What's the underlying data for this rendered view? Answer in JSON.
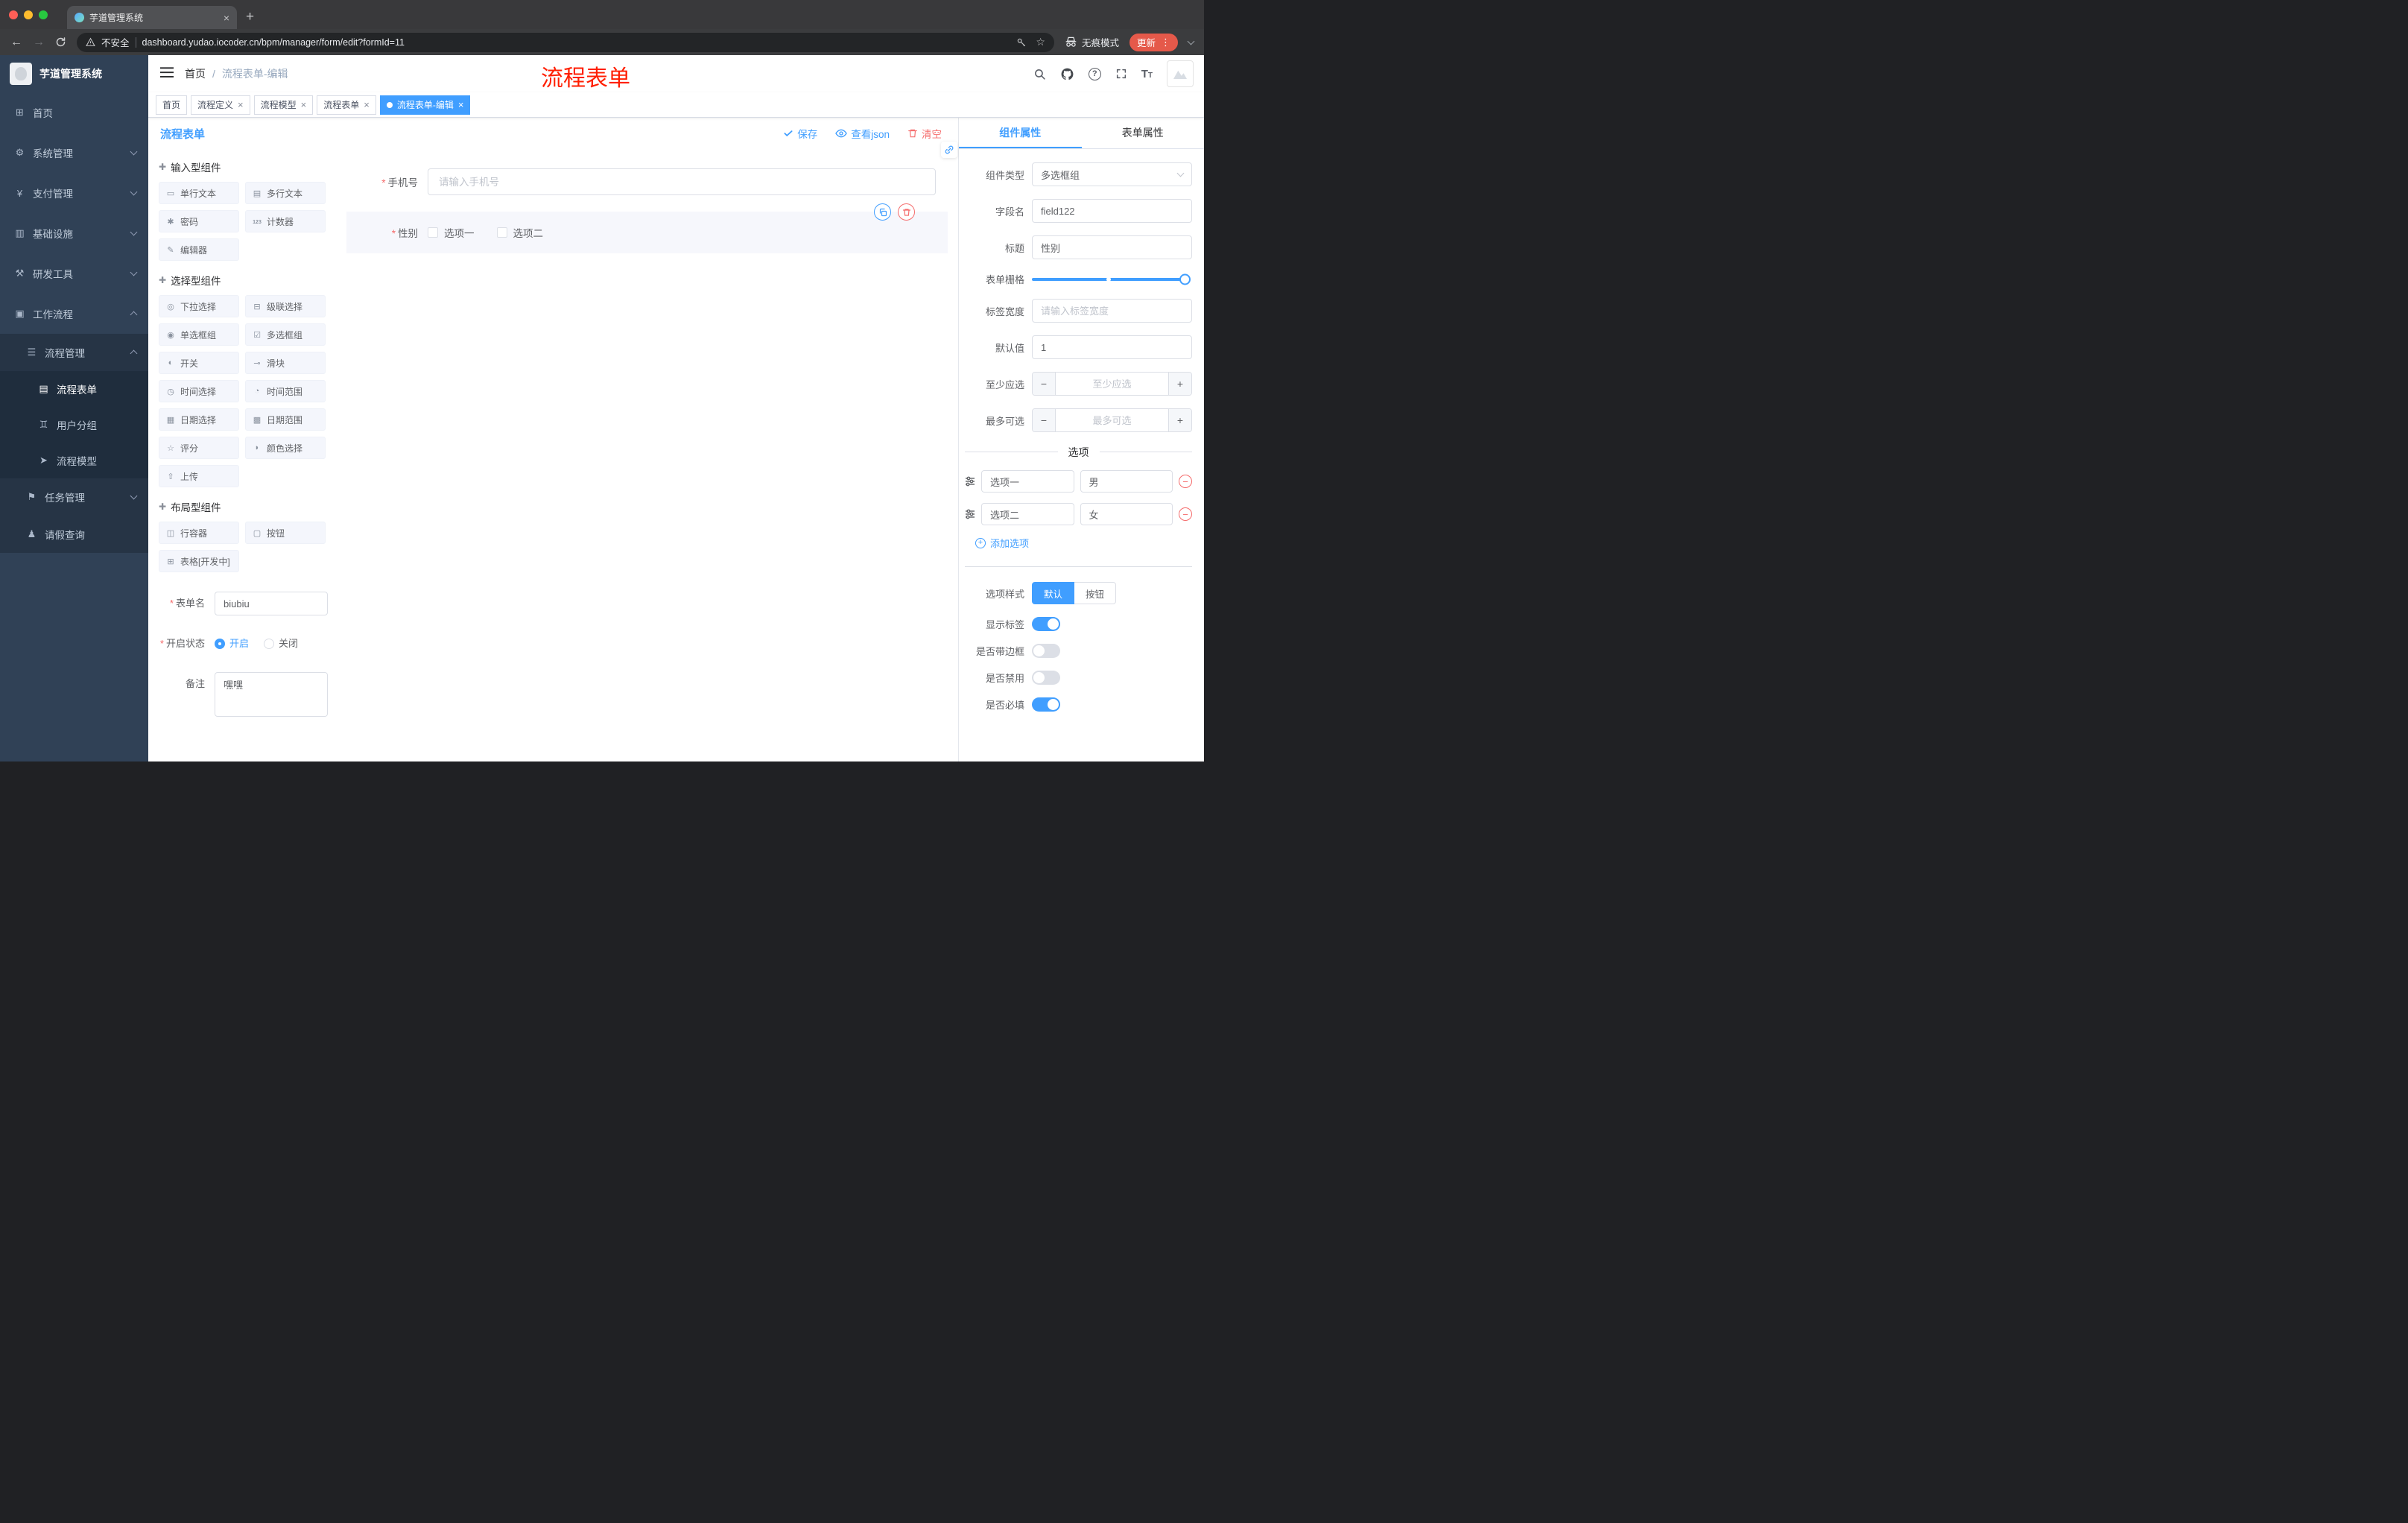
{
  "colors": {
    "accent": "#409EFF",
    "danger": "#F56C6C",
    "sidebar_bg": "#304156",
    "annotation_red": "#FF1E00",
    "update_button": "#E5594A"
  },
  "browser": {
    "tab_title": "芋道管理系统",
    "security_label": "不安全",
    "url": "dashboard.yudao.iocoder.cn/bpm/manager/form/edit?formId=11",
    "incognito_label": "无痕模式",
    "update_label": "更新"
  },
  "annotation": "流程表单",
  "sidebar": {
    "logo_title": "芋道管理系统",
    "items": [
      {
        "label": "首页",
        "icon": "home-icon"
      },
      {
        "label": "系统管理",
        "icon": "gear-icon"
      },
      {
        "label": "支付管理",
        "icon": "payment-icon"
      },
      {
        "label": "基础设施",
        "icon": "infrastructure-icon"
      },
      {
        "label": "研发工具",
        "icon": "devtools-icon"
      },
      {
        "label": "工作流程",
        "icon": "workflow-icon"
      },
      {
        "label": "流程管理",
        "icon": "process-manage-icon"
      },
      {
        "label": "流程表单",
        "icon": "process-form-icon"
      },
      {
        "label": "用户分组",
        "icon": "user-group-icon"
      },
      {
        "label": "流程模型",
        "icon": "process-model-icon"
      },
      {
        "label": "任务管理",
        "icon": "task-manage-icon"
      },
      {
        "label": "请假查询",
        "icon": "leave-query-icon"
      }
    ]
  },
  "navbar": {
    "breadcrumb_home": "首页",
    "breadcrumb_separator": "/",
    "breadcrumb_current": "流程表单-编辑"
  },
  "tags": [
    {
      "label": "首页",
      "closable": false,
      "active": false
    },
    {
      "label": "流程定义",
      "closable": true,
      "active": false
    },
    {
      "label": "流程模型",
      "closable": true,
      "active": false
    },
    {
      "label": "流程表单",
      "closable": true,
      "active": false
    },
    {
      "label": "流程表单-编辑",
      "closable": true,
      "active": true
    }
  ],
  "designer": {
    "title": "流程表单",
    "save_label": "保存",
    "view_json_label": "查看json",
    "clear_label": "清空",
    "palette": {
      "section_input": "输入型组件",
      "section_select": "选择型组件",
      "section_layout": "布局型组件",
      "input_items": [
        "单行文本",
        "多行文本",
        "密码",
        "计数器",
        "编辑器"
      ],
      "input_item_icons": [
        "single-line-text-icon",
        "multi-line-text-icon",
        "password-icon",
        "counter-icon",
        "editor-icon"
      ],
      "select_items": [
        "下拉选择",
        "级联选择",
        "单选框组",
        "多选框组",
        "开关",
        "滑块",
        "时间选择",
        "时间范围",
        "日期选择",
        "日期范围",
        "评分",
        "颜色选择",
        "上传"
      ],
      "select_item_icons": [
        "select-icon",
        "cascader-icon",
        "radio-group-icon",
        "checkbox-group-icon",
        "switch-icon",
        "slider-icon",
        "time-picker-icon",
        "time-range-icon",
        "date-picker-icon",
        "date-range-icon",
        "rate-icon",
        "color-picker-icon",
        "upload-icon"
      ],
      "layout_items": [
        "行容器",
        "按钮",
        "表格[开发中]"
      ],
      "layout_item_icons": [
        "row-container-icon",
        "button-icon",
        "table-icon"
      ]
    },
    "meta_form": {
      "name_label": "表单名",
      "name_value": "biubiu",
      "status_label": "开启状态",
      "status_on": "开启",
      "status_off": "关闭",
      "status_value": "开启",
      "remark_label": "备注",
      "remark_value": "嘿嘿"
    },
    "canvas": {
      "phone_label": "手机号",
      "phone_placeholder": "请输入手机号",
      "gender_label": "性别",
      "gender_option1": "选项一",
      "gender_option2": "选项二"
    }
  },
  "props": {
    "tab_component": "组件属性",
    "tab_form": "表单属性",
    "type_label": "组件类型",
    "type_value": "多选框组",
    "field_label": "字段名",
    "field_value": "field122",
    "title_label": "标题",
    "title_value": "性别",
    "grid_label": "表单栅格",
    "width_label": "标签宽度",
    "width_placeholder": "请输入标签宽度",
    "default_label": "默认值",
    "default_value": "1",
    "min_label": "至少应选",
    "min_placeholder": "至少应选",
    "max_label": "最多可选",
    "max_placeholder": "最多可选",
    "options_title": "选项",
    "option_rows": [
      {
        "label": "选项一",
        "value": "男"
      },
      {
        "label": "选项二",
        "value": "女"
      }
    ],
    "add_option_label": "添加选项",
    "style_label": "选项样式",
    "style_default": "默认",
    "style_button": "按钮",
    "toggle_show_label": "显示标签",
    "toggle_border": "是否带边框",
    "toggle_disabled": "是否禁用",
    "toggle_required": "是否必填"
  }
}
